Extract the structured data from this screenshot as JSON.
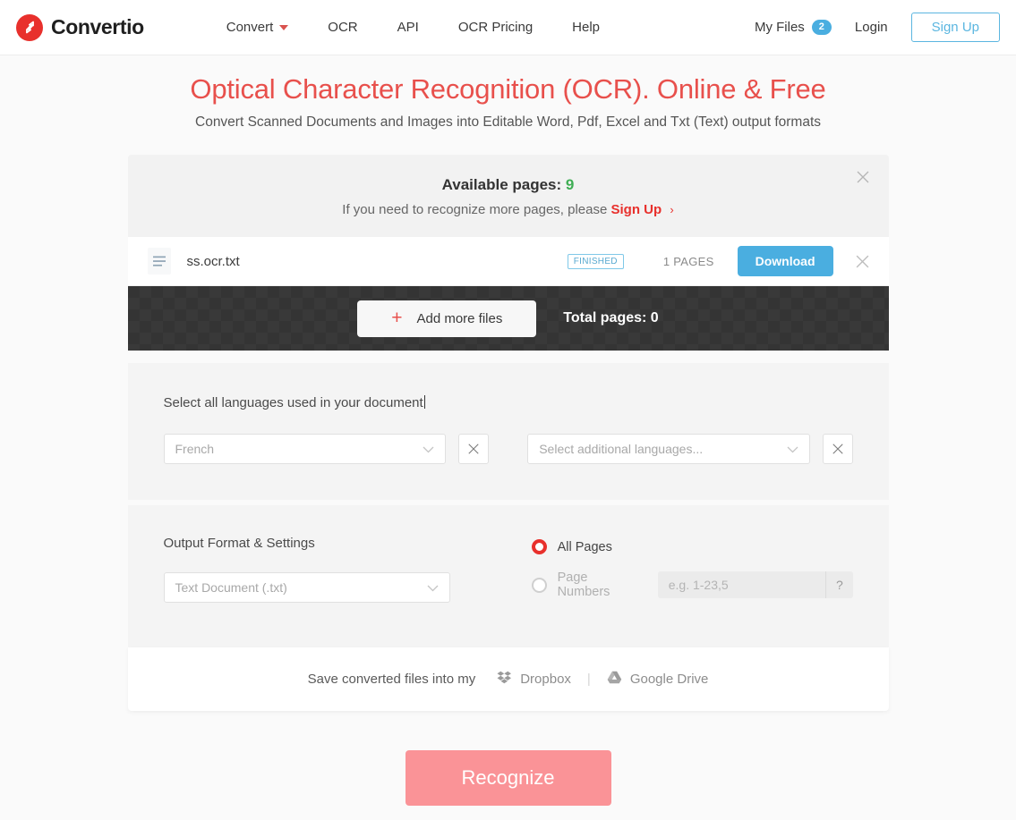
{
  "header": {
    "brand": "Convertio",
    "nav": [
      {
        "label": "Convert",
        "has_caret": true
      },
      {
        "label": "OCR",
        "has_caret": false
      },
      {
        "label": "API",
        "has_caret": false
      },
      {
        "label": "OCR Pricing",
        "has_caret": false
      },
      {
        "label": "Help",
        "has_caret": false
      }
    ],
    "my_files_label": "My Files",
    "my_files_count": "2",
    "login_label": "Login",
    "signup_label": "Sign Up"
  },
  "hero": {
    "title": "Optical Character Recognition (OCR). Online & Free",
    "subtitle": "Convert Scanned Documents and Images into Editable Word, Pdf, Excel and Txt (Text) output formats"
  },
  "notice": {
    "available_label": "Available pages:",
    "available_count": "9",
    "prompt": "If you need to recognize more pages, please",
    "link": "Sign Up",
    "arrow": "›"
  },
  "file": {
    "name": "ss.ocr.txt",
    "status": "FINISHED",
    "pages": "1 PAGES",
    "download_label": "Download"
  },
  "dark_bar": {
    "add_files_label": "Add more files",
    "plus": "+",
    "total_pages_label": "Total pages: 0"
  },
  "languages": {
    "label": "Select all languages used in your document",
    "primary_value": "French",
    "additional_placeholder": "Select additional languages..."
  },
  "output": {
    "title": "Output Format & Settings",
    "format_value": "Text Document (.txt)",
    "all_pages_label": "All Pages",
    "page_numbers_label": "Page Numbers",
    "page_numbers_placeholder": "e.g. 1-23,5",
    "help_glyph": "?"
  },
  "save": {
    "text": "Save converted files into my",
    "dropbox_label": "Dropbox",
    "gdrive_label": "Google Drive",
    "divider": "|"
  },
  "action": {
    "recognize_label": "Recognize"
  },
  "colors": {
    "brand_red": "#e8302c",
    "title_red": "#e8504c",
    "accent_blue": "#4aaee0",
    "green": "#3fae54",
    "dark_bar": "#343434",
    "recognize_disabled": "#fa9397"
  }
}
